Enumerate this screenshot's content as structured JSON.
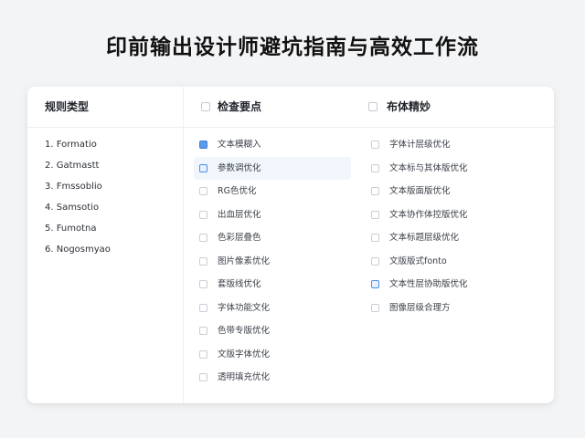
{
  "page": {
    "title": "印前输出设计师避坑指南与高效工作流"
  },
  "columns": {
    "left": {
      "title": "规则类型",
      "items": [
        "1. Formatio",
        "2. Gatmastt",
        "3. Fmssoblio",
        "4. Samsotio",
        "5. Fumotna",
        "6. Nogosmyao"
      ]
    },
    "middle": {
      "title": "检查要点",
      "items": [
        {
          "label": "文本模糊入",
          "check": "blue-filled",
          "highlight": false
        },
        {
          "label": "参数调优化",
          "check": "blue",
          "highlight": true
        },
        {
          "label": "RG色优化",
          "check": "empty",
          "highlight": false
        },
        {
          "label": "出血层优化",
          "check": "empty",
          "highlight": false
        },
        {
          "label": "色彩层叠色",
          "check": "empty",
          "highlight": false
        },
        {
          "label": "图片像素优化",
          "check": "empty",
          "highlight": false
        },
        {
          "label": "套版线优化",
          "check": "empty",
          "highlight": false
        },
        {
          "label": "字体功能文化",
          "check": "empty",
          "highlight": false
        },
        {
          "label": "色带专版优化",
          "check": "empty",
          "highlight": false
        },
        {
          "label": "文版字体优化",
          "check": "empty",
          "highlight": false
        },
        {
          "label": "透明填充优化",
          "check": "empty",
          "highlight": false
        }
      ]
    },
    "right": {
      "title": "布体精妙",
      "items": [
        {
          "label": "字体计层级优化",
          "check": "empty"
        },
        {
          "label": "文本标与其体版优化",
          "check": "empty"
        },
        {
          "label": "文本版面版优化",
          "check": "empty"
        },
        {
          "label": "文本协作体控版优化",
          "check": "empty"
        },
        {
          "label": "文本标题层级优化",
          "check": "empty"
        },
        {
          "label": "文版版式fonto",
          "check": "empty"
        },
        {
          "label": "文本性层协助版优化",
          "check": "blue"
        },
        {
          "label": "图像层级合理方",
          "check": "empty"
        }
      ]
    }
  },
  "colors": {
    "accent": "#4a8fe7",
    "highlight": "#f0f6fc",
    "background": "#f3f4f6"
  }
}
